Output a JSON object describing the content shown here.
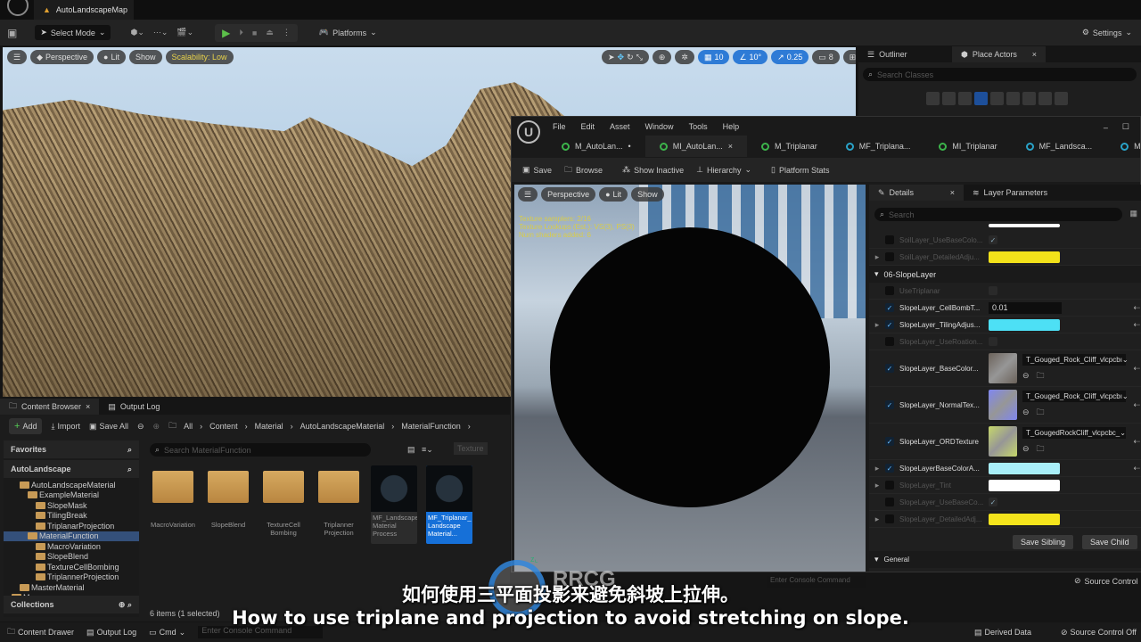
{
  "app": {
    "map_tab": "AutoLandscapeMap"
  },
  "toolbar": {
    "select_mode": "Select Mode",
    "platforms": "Platforms",
    "settings": "Settings"
  },
  "viewport": {
    "perspective": "Perspective",
    "lit": "Lit",
    "show": "Show",
    "scalability": "Scalability: Low",
    "grid": "10",
    "angle": "10°",
    "scale": "0.25",
    "camera": "8"
  },
  "outliner": {
    "tab1": "Outliner",
    "tab2": "Place Actors",
    "search_placeholder": "Search Classes"
  },
  "material_editor": {
    "menu": [
      "File",
      "Edit",
      "Asset",
      "Window",
      "Tools",
      "Help"
    ],
    "tabs": [
      {
        "label": "M_AutoLan...",
        "dot": "green",
        "suffix": "•"
      },
      {
        "label": "MI_AutoLan...",
        "dot": "green",
        "suffix": "×",
        "active": true
      },
      {
        "label": "M_Triplanar",
        "dot": "green",
        "suffix": ""
      },
      {
        "label": "MF_Triplana...",
        "dot": "blue",
        "suffix": ""
      },
      {
        "label": "MI_Triplanar",
        "dot": "green",
        "suffix": ""
      },
      {
        "label": "MF_Landsca...",
        "dot": "blue",
        "suffix": ""
      },
      {
        "label": "MF_Triplan...",
        "dot": "blue",
        "suffix": "•"
      }
    ],
    "toolbar": {
      "save": "Save",
      "browse": "Browse",
      "show_inactive": "Show Inactive",
      "hierarchy": "Hierarchy",
      "platform_stats": "Platform Stats"
    },
    "viewport": {
      "perspective": "Perspective",
      "lit": "Lit",
      "show": "Show",
      "stats": [
        "Texture samplers: 2/16",
        "Texture Lookups (Est.): VS(3), PS(3)",
        "Num shaders added: 6"
      ]
    },
    "details": {
      "tab1": "Details",
      "tab2": "Layer Parameters",
      "search_placeholder": "Search",
      "rows": [
        {
          "type": "param",
          "name": "SoilLayer_UseBaseColo...",
          "enabled": false,
          "checked": false,
          "value": "check"
        },
        {
          "type": "param",
          "name": "SoilLayer_DetailedAdju...",
          "enabled": false,
          "checked": false,
          "expand": true,
          "value": "swatch",
          "color": "#f2e21a"
        },
        {
          "type": "header",
          "name": "06-SlopeLayer"
        },
        {
          "type": "param",
          "name": "UseTriplanar",
          "enabled": false,
          "checked": false,
          "value": "box"
        },
        {
          "type": "param",
          "name": "SlopeLayer_CellBombT...",
          "enabled": true,
          "checked": true,
          "value": "number",
          "number": "0.01"
        },
        {
          "type": "param",
          "name": "SlopeLayer_TilingAdjus...",
          "enabled": true,
          "checked": true,
          "expand": true,
          "value": "swatch",
          "color": "#4de0f5"
        },
        {
          "type": "param",
          "name": "SlopeLayer_UseRoation...",
          "enabled": false,
          "checked": false,
          "value": "box"
        },
        {
          "type": "texture",
          "name": "SlopeLayer_BaseColor...",
          "enabled": true,
          "checked": true,
          "texture": "T_Gouged_Rock_Cliff_vlcpcbı",
          "color": "#6b625a"
        },
        {
          "type": "texture",
          "name": "SlopeLayer_NormalTex...",
          "enabled": true,
          "checked": true,
          "texture": "T_Gouged_Rock_Cliff_vlcpcbı",
          "color": "#7f86f0"
        },
        {
          "type": "texture",
          "name": "SlopeLayer_ORDTexture",
          "enabled": true,
          "checked": true,
          "texture": "T_GougedRockCliff_vlcpcbc_",
          "color": "#c6d86a"
        },
        {
          "type": "param",
          "name": "SlopeLayerBaseColorA...",
          "enabled": true,
          "checked": true,
          "expand": true,
          "value": "swatch",
          "color": "#a8eef8"
        },
        {
          "type": "param",
          "name": "SlopeLayer_Tint",
          "enabled": false,
          "checked": false,
          "expand": true,
          "value": "swatch",
          "color": "#ffffff"
        },
        {
          "type": "param",
          "name": "SlopeLayer_UseBaseCo...",
          "enabled": false,
          "checked": false,
          "value": "check"
        },
        {
          "type": "param",
          "name": "SlopeLayer_DetailedAdj...",
          "enabled": false,
          "checked": false,
          "expand": true,
          "value": "swatch",
          "color": "#f5e51c"
        }
      ],
      "save_sibling": "Save Sibling",
      "save_child": "Save Child",
      "general": "General"
    },
    "console_placeholder": "Enter Console Command",
    "source_control": "Source Control"
  },
  "content_browser": {
    "tab1": "Content Browser",
    "tab2": "Output Log",
    "add": "Add",
    "import": "Import",
    "save_all": "Save All",
    "breadcrumb": [
      "All",
      "Content",
      "Material",
      "AutoLandscapeMaterial",
      "MaterialFunction"
    ],
    "favorites": "Favorites",
    "root": "AutoLandscape",
    "collections": "Collections",
    "tree": [
      {
        "label": "AutoLandscapeMaterial",
        "indent": 2
      },
      {
        "label": "ExampleMaterial",
        "indent": 3
      },
      {
        "label": "SlopeMask",
        "indent": 4
      },
      {
        "label": "TilingBreak",
        "indent": 4
      },
      {
        "label": "TriplanarProjection",
        "indent": 4
      },
      {
        "label": "MaterialFunction",
        "indent": 3,
        "selected": true
      },
      {
        "label": "MacroVariation",
        "indent": 4
      },
      {
        "label": "SlopeBlend",
        "indent": 4
      },
      {
        "label": "TextureCellBombing",
        "indent": 4
      },
      {
        "label": "TriplannerProjection",
        "indent": 4
      },
      {
        "label": "MasterMaterial",
        "indent": 2
      },
      {
        "label": "Megascans",
        "indent": 1
      }
    ],
    "search_placeholder": "Search MaterialFunction",
    "filter": "Texture",
    "items": [
      {
        "label": "MacroVariation",
        "kind": "folder"
      },
      {
        "label": "SlopeBlend",
        "kind": "folder"
      },
      {
        "label": "TextureCell Bombing",
        "kind": "folder"
      },
      {
        "label": "Triplanner Projection",
        "kind": "folder"
      },
      {
        "label": "MF_Landscape Material Process",
        "kind": "material"
      },
      {
        "label": "MF_Triplanar_ Landscape Material...",
        "kind": "material",
        "selected": true
      }
    ],
    "count": "6 items (1 selected)"
  },
  "statusbar": {
    "content_drawer": "Content Drawer",
    "output_log": "Output Log",
    "cmd": "Cmd",
    "console_placeholder": "Enter Console Command",
    "derived_data": "Derived Data",
    "source_control": "Source Control Off"
  },
  "subtitles": {
    "zh": "如何使用三平面投影来避免斜坡上拉伸。",
    "en": "How to use triplane and projection to avoid stretching on slope."
  },
  "watermark": "RRCG"
}
